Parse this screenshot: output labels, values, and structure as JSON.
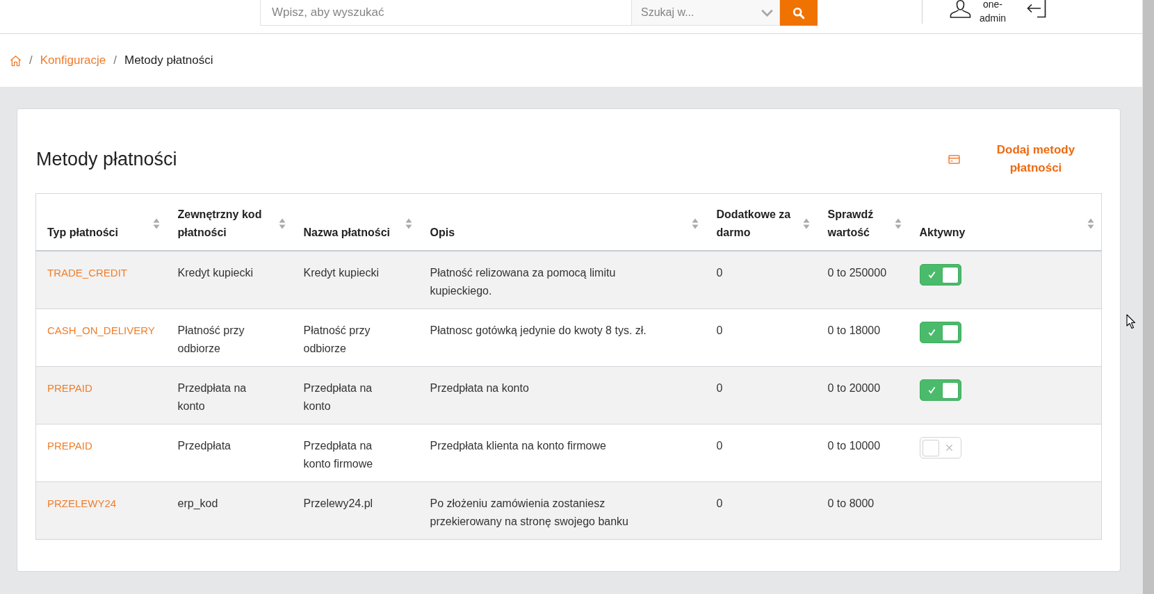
{
  "header": {
    "search": {
      "placeholder": "Wpisz, aby wyszukać"
    },
    "scope_select": {
      "value": "Szukaj w..."
    },
    "user": {
      "name": "one-admin"
    }
  },
  "breadcrumb": [
    {
      "kind": "home"
    },
    {
      "kind": "separator",
      "label": "/"
    },
    {
      "kind": "link",
      "label": "Konfiguracje"
    },
    {
      "kind": "separator",
      "label": "/"
    },
    {
      "kind": "current",
      "label": "Metody płatności"
    }
  ],
  "panel": {
    "title": "Metody płatności",
    "add_button": "Dodaj metody płatności"
  },
  "table": {
    "columns": [
      {
        "label": "Typ płatności",
        "kind": "link",
        "sortable": true
      },
      {
        "label": "Zewnętrzny kod płatności",
        "kind": "text",
        "sortable": true
      },
      {
        "label": "Nazwa płatności",
        "kind": "text",
        "sortable": true
      },
      {
        "label": "Opis",
        "kind": "text",
        "sortable": true
      },
      {
        "label": "Dodatkowe za darmo",
        "kind": "text",
        "sortable": true
      },
      {
        "label": "Sprawdź wartość",
        "kind": "text",
        "sortable": true
      },
      {
        "label": "Aktywny",
        "kind": "toggle",
        "sortable": true
      }
    ],
    "rows": [
      {
        "cells": [
          "TRADE_CREDIT",
          "Kredyt kupiecki",
          "Kredyt kupiecki",
          "Płatność relizowana za pomocą limitu kupieckiego.",
          "0",
          "0 to 250000"
        ],
        "active": true
      },
      {
        "cells": [
          "CASH_ON_DELIVERY",
          "Płatność przy odbiorze",
          "Płatność przy odbiorze",
          "Płatnosc gotówką jedynie do kwoty 8 tys. zł.",
          "0",
          "0 to 18000"
        ],
        "active": true
      },
      {
        "cells": [
          "PREPAID",
          "Przedpłata na konto",
          "Przedpłata na konto",
          "Przedpłata na konto",
          "0",
          "0 to 20000"
        ],
        "active": true
      },
      {
        "cells": [
          "PREPAID",
          "Przedpłata",
          "Przedpłata na konto firmowe",
          "Przedpłata klienta na konto firmowe",
          "0",
          "0 to 10000"
        ],
        "active": false
      },
      {
        "cells": [
          "PRZELEWY24",
          "erp_kod",
          "Przelewy24.pl",
          "Po złożeniu zamówienia zostaniesz przekierowany na stronę swojego banku",
          "0",
          "0 to 8000"
        ]
      }
    ]
  }
}
